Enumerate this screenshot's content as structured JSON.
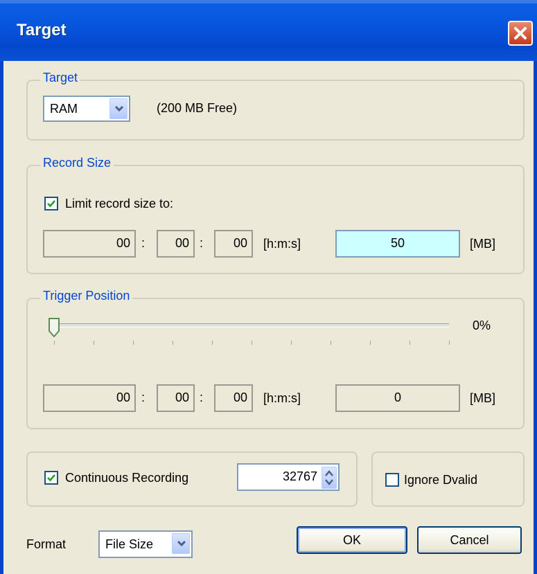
{
  "window": {
    "title": "Target"
  },
  "target_group": {
    "legend": "Target",
    "selected": "RAM",
    "free_text": "(200 MB Free)"
  },
  "record_group": {
    "legend": "Record Size",
    "limit_label": "Limit record size to:",
    "limit_checked": true,
    "hours": "00",
    "minutes": "00",
    "seconds": "00",
    "sep": ":",
    "time_unit": "[h:m:s]",
    "size": "50",
    "size_unit": "[MB]"
  },
  "trigger_group": {
    "legend": "Trigger Position",
    "percent": "0%",
    "slider_value": 0,
    "hours": "00",
    "minutes": "00",
    "seconds": "00",
    "sep": ":",
    "time_unit": "[h:m:s]",
    "size": "0",
    "size_unit": "[MB]"
  },
  "continuous": {
    "label": "Continuous Recording",
    "checked": true,
    "value": "32767"
  },
  "ignore": {
    "label": "Ignore Dvalid",
    "checked": false
  },
  "format": {
    "label": "Format",
    "selected": "File Size"
  },
  "buttons": {
    "ok": "OK",
    "cancel": "Cancel"
  },
  "colors": {
    "title_bar": "#0a5fe6",
    "legend_text": "#0046d5",
    "active_field": "#ccffff"
  },
  "icons": [
    "close-icon",
    "chevron-down-icon",
    "checkmark-icon",
    "spin-arrows-icon",
    "slider-thumb-icon"
  ]
}
